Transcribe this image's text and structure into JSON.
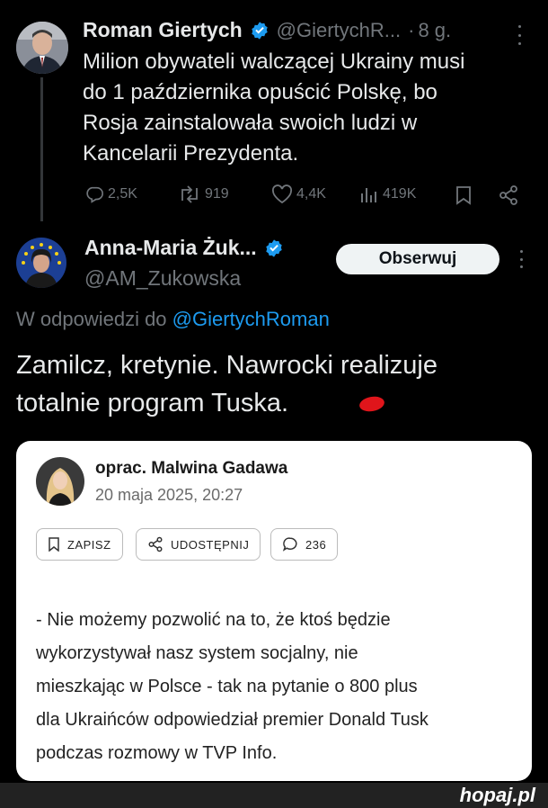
{
  "tweet1": {
    "author_name": "Roman Giertych",
    "handle": "@GiertychR...",
    "separator": "·",
    "time": "8 g.",
    "text_lines": [
      "Milion obywateli walczącej Ukrainy musi",
      "do 1 października opuścić Polskę, bo",
      "Rosja zainstalowała swoich ludzi w",
      "Kancelarii Prezydenta."
    ],
    "replies": "2,5K",
    "reposts": "919",
    "likes": "4,4K",
    "views": "419K"
  },
  "tweet2": {
    "author_name": "Anna-Maria Żuk...",
    "handle": "@AM_Zukowska",
    "follow_label": "Obserwuj",
    "reply_prefix": "W odpowiedzi do",
    "reply_to": "@GiertychRoman",
    "text_lines": [
      "Zamilcz, kretynie. Nawrocki realizuje",
      "totalnie program Tuska."
    ]
  },
  "article": {
    "author": "oprac. Malwina Gadawa",
    "date": "20 maja 2025, 20:27",
    "save_label": "ZAPISZ",
    "share_label": "UDOSTĘPNIJ",
    "comments_count": "236",
    "body_lines": [
      "- Nie możemy pozwolić na to, że ktoś będzie",
      "wykorzystywał nasz system socjalny, nie",
      "mieszkając w Polsce - tak na pytanie o 800 plus",
      "dla Ukraińców odpowiedział premier Donald Tusk",
      "podczas rozmowy w TVP Info."
    ]
  },
  "footer": {
    "logo": "hopaj.pl"
  },
  "colors": {
    "background": "#000000",
    "verified": "#1d9bf0",
    "link": "#1d9bf0",
    "secondary": "#71767b"
  }
}
